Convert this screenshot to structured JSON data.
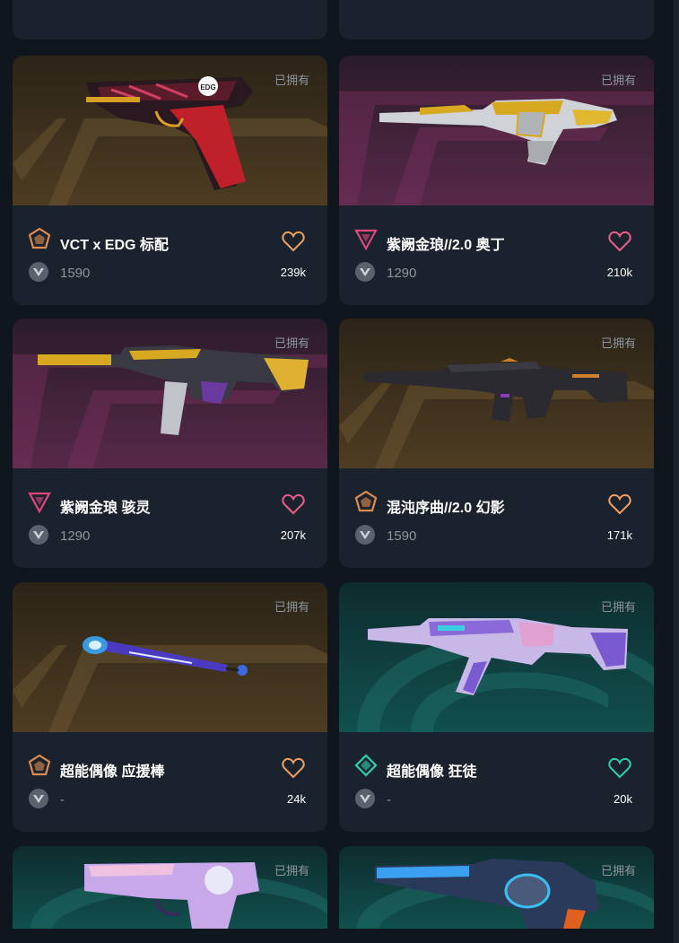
{
  "owned_label": "已拥有",
  "colors": {
    "gold_tier": "#e08c4f",
    "purple_tier": "#e0467c",
    "teal_tier": "#2bd1b0",
    "heart_gold": "#f0a060",
    "heart_purple": "#f05d8c",
    "heart_teal": "#2bd1b0"
  },
  "items": [
    {
      "name": "VCT x EDG 标配",
      "price": "1590",
      "likes": "239k",
      "tier_icon": "gold-pentagon-tier-icon",
      "theme": "gold"
    },
    {
      "name": "紫阙金琅//2.0 奥丁",
      "price": "1290",
      "likes": "210k",
      "tier_icon": "purple-triangle-tier-icon",
      "theme": "purple"
    },
    {
      "name": "紫阙金琅 骇灵",
      "price": "1290",
      "likes": "207k",
      "tier_icon": "purple-triangle-tier-icon",
      "theme": "purple"
    },
    {
      "name": "混沌序曲//2.0 幻影",
      "price": "1590",
      "likes": "171k",
      "tier_icon": "gold-pentagon-tier-icon",
      "theme": "gold"
    },
    {
      "name": "超能偶像 应援棒",
      "price": "-",
      "likes": "24k",
      "tier_icon": "gold-pentagon-tier-icon",
      "theme": "gold"
    },
    {
      "name": "超能偶像 狂徒",
      "price": "-",
      "likes": "20k",
      "tier_icon": "teal-diamond-tier-icon",
      "theme": "teal"
    }
  ],
  "partial_bottom": [
    {
      "owned": "已拥有",
      "theme": "teal"
    },
    {
      "owned": "已拥有",
      "theme": "teal"
    }
  ]
}
